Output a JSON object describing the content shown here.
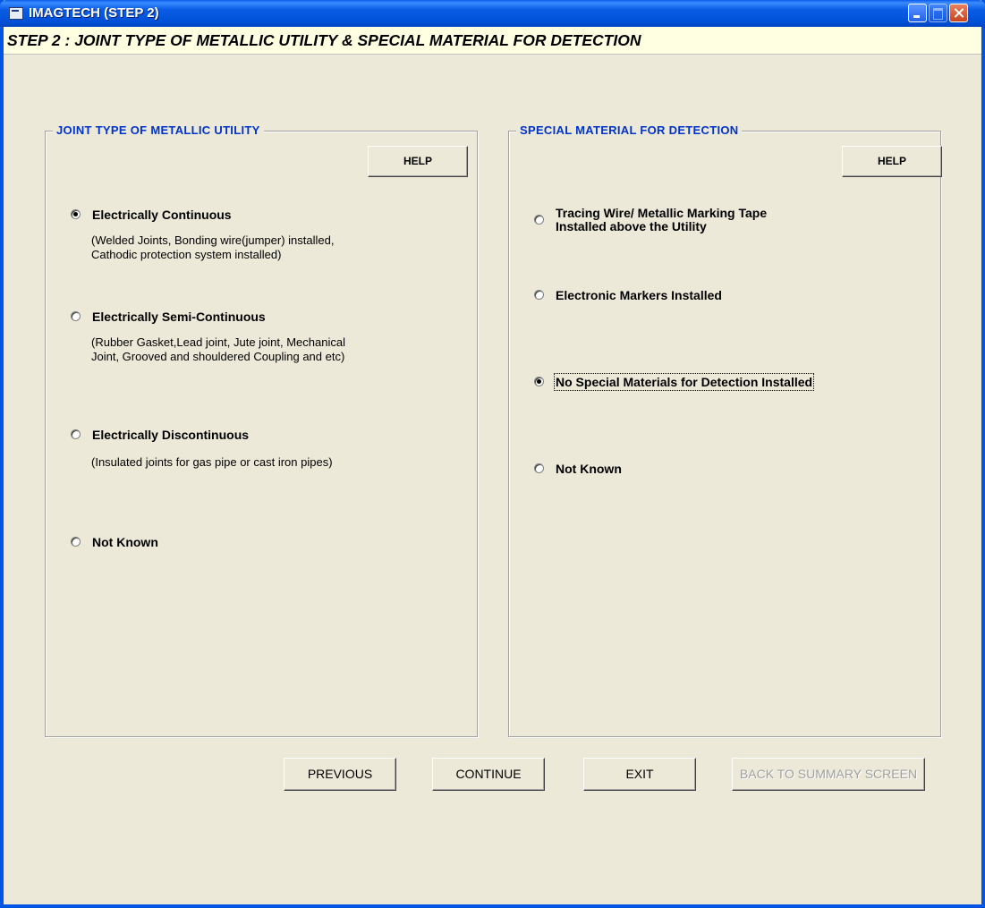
{
  "window": {
    "title": "IMAGTECH (STEP 2)",
    "step_title": "STEP 2 : JOINT TYPE OF METALLIC UTILITY &  SPECIAL  MATERIAL FOR DETECTION"
  },
  "left_group": {
    "legend": "JOINT TYPE OF METALLIC UTILITY",
    "help_label": "HELP",
    "options": [
      {
        "label": "Electrically Continuous",
        "selected": true,
        "desc1": "(Welded Joints, Bonding wire(jumper) installed,",
        "desc2": "Cathodic protection system installed)"
      },
      {
        "label": "Electrically Semi-Continuous",
        "selected": false,
        "desc1": "(Rubber Gasket,Lead joint, Jute joint, Mechanical",
        "desc2": "Joint, Grooved and shouldered Coupling and etc)"
      },
      {
        "label": "Electrically Discontinuous",
        "selected": false,
        "desc1": "(Insulated joints for gas pipe or cast iron pipes)",
        "desc2": ""
      },
      {
        "label": "Not Known",
        "selected": false,
        "desc1": "",
        "desc2": ""
      }
    ]
  },
  "right_group": {
    "legend": "SPECIAL MATERIAL FOR DETECTION",
    "help_label": "HELP",
    "options": [
      {
        "label_line1": "Tracing Wire/ Metallic Marking Tape",
        "label_line2": "Installed above the Utility",
        "selected": false
      },
      {
        "label": "Electronic Markers Installed",
        "selected": false
      },
      {
        "label": "No Special Materials for Detection Installed",
        "selected": true
      },
      {
        "label": "Not Known",
        "selected": false
      }
    ]
  },
  "footer": {
    "previous": "PREVIOUS",
    "continue": "CONTINUE",
    "exit": "EXIT",
    "back_to_summary": "BACK TO SUMMARY SCREEN"
  },
  "colors": {
    "title_bar": "#0055e5",
    "legend_text": "#0033cc",
    "step_bar_bg": "#ffffe1",
    "window_bg": "#ece9d8"
  }
}
